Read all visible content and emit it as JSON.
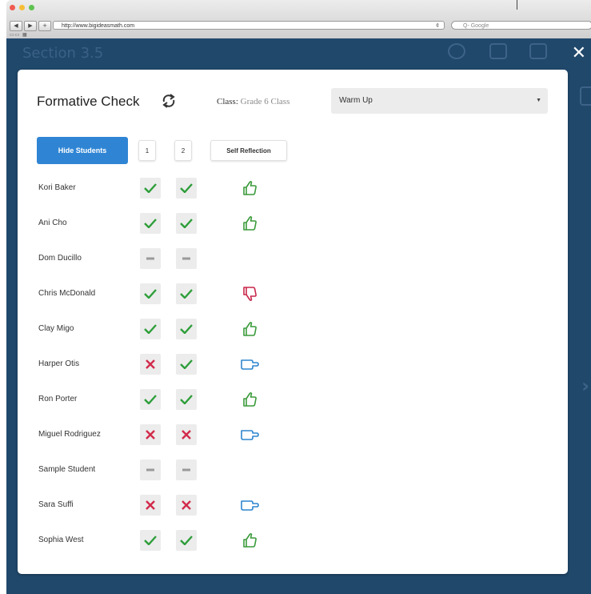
{
  "browser": {
    "url": "http://www.bigideasmath.com",
    "search_placeholder": "Q- Google"
  },
  "app": {
    "background_title": "Section 3.5"
  },
  "modal": {
    "title": "Formative Check",
    "class_label": "Class:",
    "class_value": "Grade 6 Class",
    "assignment_select": "Warm Up",
    "hide_students_label": "Hide Students",
    "question_labels": [
      "1",
      "2"
    ],
    "self_reflection_label": "Self Reflection"
  },
  "colors": {
    "check": "#2e9e3a",
    "cross": "#d22b4b",
    "thumb_up": "#3a9a3a",
    "thumb_down": "#c9274a",
    "thumb_side": "#2e86cf",
    "primary_button": "#2f85d4",
    "app_background": "#20486b"
  },
  "students": [
    {
      "name": "Kori Baker",
      "q1": "check",
      "q2": "check",
      "reflection": "thumbs-up"
    },
    {
      "name": "Ani Cho",
      "q1": "check",
      "q2": "check",
      "reflection": "thumbs-up"
    },
    {
      "name": "Dom Ducillo",
      "q1": "none",
      "q2": "none",
      "reflection": "none"
    },
    {
      "name": "Chris McDonald",
      "q1": "check",
      "q2": "check",
      "reflection": "thumbs-down"
    },
    {
      "name": "Clay Migo",
      "q1": "check",
      "q2": "check",
      "reflection": "thumbs-up"
    },
    {
      "name": "Harper Otis",
      "q1": "cross",
      "q2": "check",
      "reflection": "thumbs-sideways"
    },
    {
      "name": "Ron Porter",
      "q1": "check",
      "q2": "check",
      "reflection": "thumbs-up"
    },
    {
      "name": "Miguel Rodriguez",
      "q1": "cross",
      "q2": "cross",
      "reflection": "thumbs-sideways"
    },
    {
      "name": "Sample Student",
      "q1": "none",
      "q2": "none",
      "reflection": "none"
    },
    {
      "name": "Sara Suffi",
      "q1": "cross",
      "q2": "cross",
      "reflection": "thumbs-sideways"
    },
    {
      "name": "Sophia West",
      "q1": "check",
      "q2": "check",
      "reflection": "thumbs-up"
    }
  ]
}
